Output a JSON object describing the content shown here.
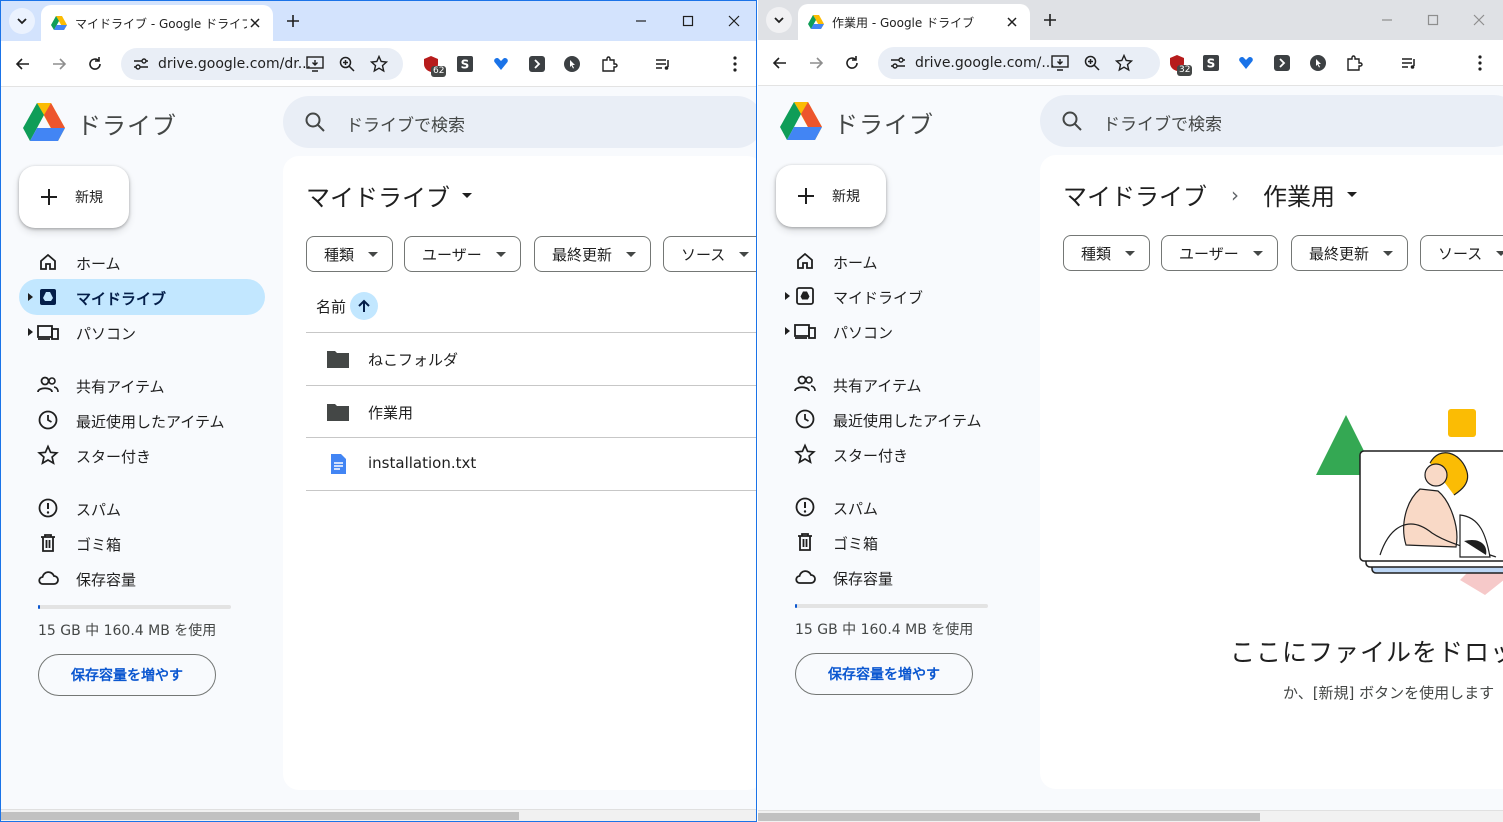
{
  "left": {
    "tab_title": "マイドライブ - Google ドライブ",
    "url": "drive.google.com/dr...",
    "extension_badge": "62",
    "brand": "ドライブ",
    "search_placeholder": "ドライブで検索",
    "new_label": "新規",
    "nav": {
      "home": "ホーム",
      "my_drive": "マイドライブ",
      "computers": "パソコン",
      "shared": "共有アイテム",
      "recent": "最近使用したアイテム",
      "starred": "スター付き",
      "spam": "スパム",
      "trash": "ゴミ箱",
      "storage": "保存容量"
    },
    "quota_text": "15 GB 中 160.4 MB を使用",
    "quota_used_fraction": 0.0104,
    "quota_button": "保存容量を増やす",
    "title": "マイドライブ",
    "chips": {
      "type": "種類",
      "people": "ユーザー",
      "modified": "最終更新",
      "source": "ソース"
    },
    "name_header": "名前",
    "files": [
      {
        "name": "ねこフォルダ",
        "kind": "folder-icon"
      },
      {
        "name": "作業用",
        "kind": "folder-icon"
      },
      {
        "name": "installation.txt",
        "kind": "doc-icon"
      }
    ]
  },
  "right": {
    "tab_title": "作業用 - Google ドライブ",
    "url": "drive.google.com/...",
    "extension_badge": "32",
    "brand": "ドライブ",
    "search_placeholder": "ドライブで検索",
    "new_label": "新規",
    "nav": {
      "home": "ホーム",
      "my_drive": "マイドライブ",
      "computers": "パソコン",
      "shared": "共有アイテム",
      "recent": "最近使用したアイテム",
      "starred": "スター付き",
      "spam": "スパム",
      "trash": "ゴミ箱",
      "storage": "保存容量"
    },
    "quota_text": "15 GB 中 160.4 MB を使用",
    "quota_used_fraction": 0.0104,
    "quota_button": "保存容量を増やす",
    "breadcrumb_parent": "マイドライブ",
    "breadcrumb_separator": "›",
    "title": "作業用",
    "chips": {
      "type": "種類",
      "people": "ユーザー",
      "modified": "最終更新",
      "source": "ソース"
    },
    "empty_title": "ここにファイルをドロップ",
    "empty_sub": "か、[新規] ボタンを使用します"
  },
  "colors": {
    "active_tab_strip": "#d3e3fd",
    "inactive_tab_strip": "#dfe1e5",
    "nav_active": "#c2e7ff",
    "link_blue": "#0b57d0",
    "folder": "#444746",
    "doc_blue": "#4285f4"
  }
}
